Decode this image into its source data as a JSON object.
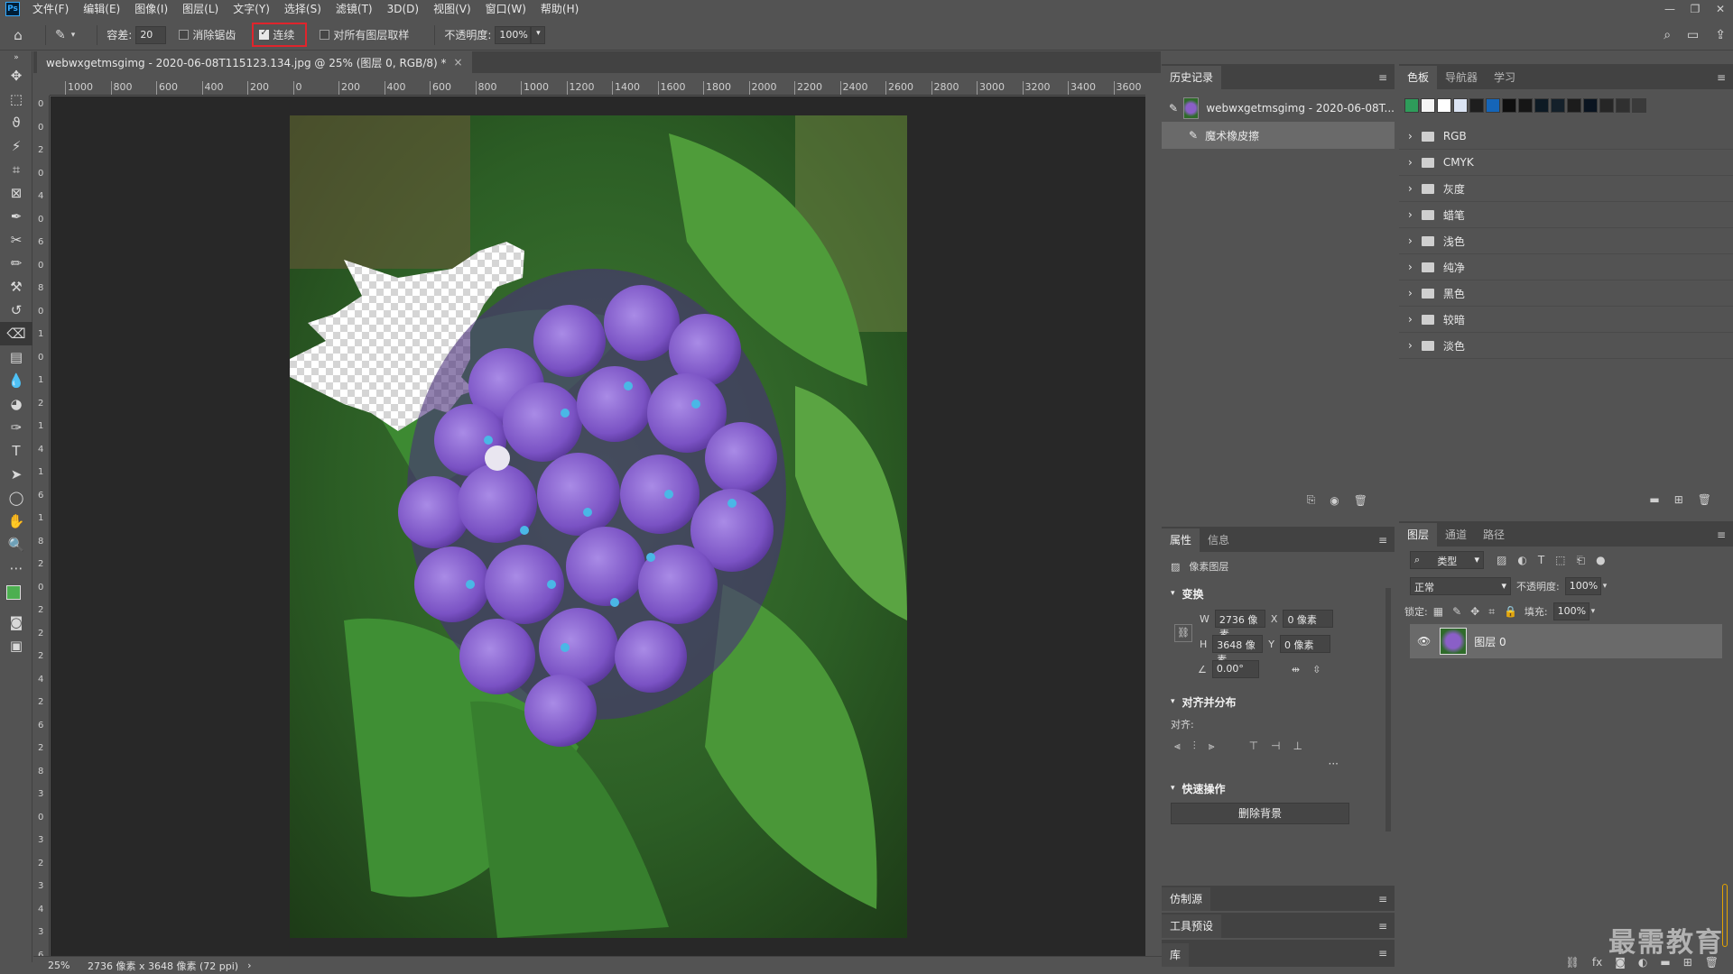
{
  "menubar": {
    "app_logo": "Ps",
    "items": [
      "文件(F)",
      "编辑(E)",
      "图像(I)",
      "图层(L)",
      "文字(Y)",
      "选择(S)",
      "滤镜(T)",
      "3D(D)",
      "视图(V)",
      "窗口(W)",
      "帮助(H)"
    ],
    "window_controls": [
      "—",
      "❐",
      "✕"
    ]
  },
  "options": {
    "tolerance_label": "容差:",
    "tolerance_value": "20",
    "antialias_label": "消除锯齿",
    "contiguous_label": "连续",
    "all_layers_label": "对所有图层取样",
    "opacity_label": "不透明度:",
    "opacity_value": "100%"
  },
  "document": {
    "tab_title": "webwxgetmsgimg - 2020-06-08T115123.134.jpg @ 25% (图层 0, RGB/8) *",
    "close_glyph": "×",
    "ruler_top_labels": [
      "1000",
      "800",
      "600",
      "400",
      "200",
      "0",
      "200",
      "400",
      "600",
      "800",
      "1000",
      "1200",
      "1400",
      "1600",
      "1800",
      "2000",
      "2200",
      "2400",
      "2600",
      "2800",
      "3000",
      "3200",
      "3400",
      "3600"
    ],
    "ruler_left_labels": [
      "0",
      "0",
      "2",
      "0",
      "4",
      "0",
      "6",
      "0",
      "8",
      "0",
      "1",
      "0",
      "1",
      "2",
      "1",
      "4",
      "1",
      "6",
      "1",
      "8",
      "2",
      "0",
      "2",
      "2",
      "2",
      "4",
      "2",
      "6",
      "2",
      "8",
      "3",
      "0",
      "3",
      "2",
      "3",
      "4",
      "3",
      "6"
    ]
  },
  "statusbar": {
    "zoom": "25%",
    "info": "2736 像素 x 3648 像素 (72 ppi)",
    "arrow": "›"
  },
  "history": {
    "tabs": [
      "历史记录"
    ],
    "snapshot_label": "webwxgetmsgimg - 2020-06-08T...",
    "steps": [
      "魔术橡皮擦"
    ]
  },
  "properties": {
    "tabs": [
      "属性",
      "信息"
    ],
    "layer_type": "像素图层",
    "transform_title": "变换",
    "w_label": "W",
    "w_value": "2736 像素",
    "h_label": "H",
    "h_value": "3648 像素",
    "x_label": "X",
    "x_value": "0 像素",
    "y_label": "Y",
    "y_value": "0 像素",
    "angle_value": "0.00°",
    "align_title": "对齐并分布",
    "align_label": "对齐:",
    "more": "···",
    "quick_title": "快速操作",
    "remove_bg_button": "删除背景"
  },
  "collapsed_panels": [
    "仿制源",
    "工具预设",
    "库"
  ],
  "swatches": {
    "tabs": [
      "色板",
      "导航器",
      "学习"
    ],
    "colors": [
      "#2e9c5a",
      "#f4f4f4",
      "#ffffff",
      "#dbe4f4",
      "#1e1e1e",
      "#1565b8",
      "#0f0f0f",
      "#161616",
      "#0d1a24",
      "#14202a",
      "#1c1c1c",
      "#0a1420",
      "#262626",
      "#303030",
      "#3a3a3a"
    ],
    "groups": [
      "RGB",
      "CMYK",
      "灰度",
      "蜡笔",
      "浅色",
      "纯净",
      "黑色",
      "较暗",
      "淡色"
    ]
  },
  "layers": {
    "tabs": [
      "图层",
      "通道",
      "路径"
    ],
    "filter_label": "类型",
    "blend_mode": "正常",
    "opacity_label": "不透明度:",
    "opacity_value": "100%",
    "lock_label": "锁定:",
    "fill_label": "填充:",
    "fill_value": "100%",
    "layer_name": "图层 0"
  },
  "watermark": "最需教育"
}
